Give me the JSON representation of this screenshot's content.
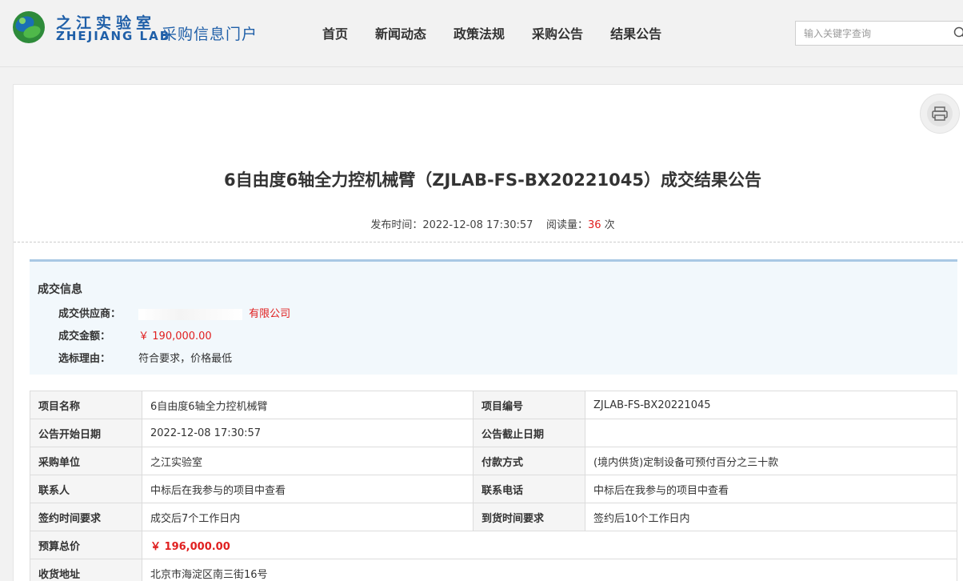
{
  "header": {
    "logo_cn": "之江实验室",
    "logo_en": "ZHEJIANG LAB",
    "portal_title": "采购信息门户",
    "nav": [
      "首页",
      "新闻动态",
      "政策法规",
      "采购公告",
      "结果公告"
    ],
    "search_placeholder": "输入关键字查询"
  },
  "notice": {
    "title": "6自由度6轴全力控机械臂（ZJLAB-FS-BX20221045）成交结果公告",
    "publish_label": "发布时间：",
    "publish_time": "2022-12-08 17:30:57",
    "views_label": "阅读量：",
    "views": "36",
    "views_unit": "次"
  },
  "deal": {
    "heading": "成交信息",
    "supplier_label": "成交供应商：",
    "supplier_value": "有限公司",
    "amount_label": "成交金额：",
    "amount_value": "￥ 190,000.00",
    "reason_label": "选标理由：",
    "reason_value": "符合要求，价格最低"
  },
  "table": {
    "rows": [
      {
        "k1": "项目名称",
        "v1": "6自由度6轴全力控机械臂",
        "k2": "项目编号",
        "v2": "ZJLAB-FS-BX20221045"
      },
      {
        "k1": "公告开始日期",
        "v1": "2022-12-08 17:30:57",
        "k2": "公告截止日期",
        "v2": ""
      },
      {
        "k1": "采购单位",
        "v1": "之江实验室",
        "k2": "付款方式",
        "v2": "(境内供货)定制设备可预付百分之三十款"
      },
      {
        "k1": "联系人",
        "v1": "中标后在我参与的项目中查看",
        "k2": "联系电话",
        "v2": "中标后在我参与的项目中查看"
      },
      {
        "k1": "签约时间要求",
        "v1": "成交后7个工作日内",
        "k2": "到货时间要求",
        "v2": "签约后10个工作日内"
      }
    ],
    "budget_label": "预算总价",
    "budget_value": "￥ 196,000.00",
    "address_label": "收货地址",
    "address_value": "北京市海淀区南三街16号"
  },
  "colors": {
    "brand": "#1f5fa8",
    "accent_red": "#e02020"
  }
}
